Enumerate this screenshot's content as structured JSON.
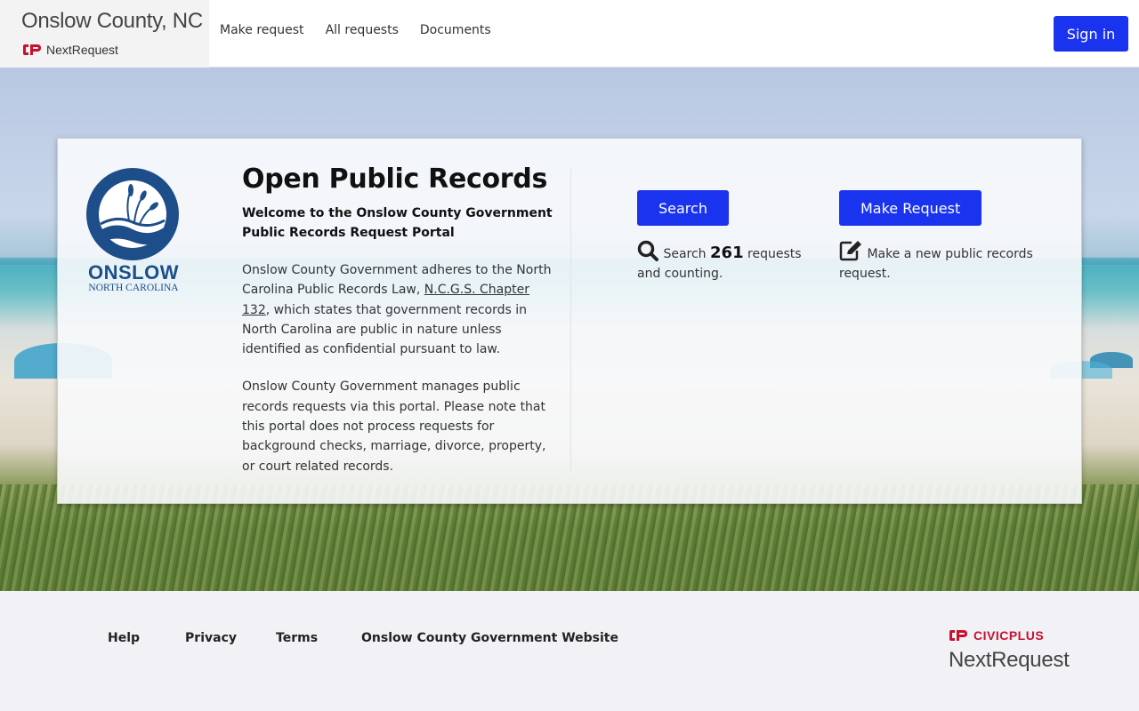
{
  "header": {
    "brand_title": "Onslow County, NC",
    "brand_sub": "NextRequest",
    "nav": [
      "Make request",
      "All requests",
      "Documents"
    ],
    "signin_label": "Sign in"
  },
  "logo": {
    "name": "ONSLOW",
    "state": "NORTH CAROLINA"
  },
  "intro": {
    "title": "Open Public Records",
    "welcome": "Welcome to the Onslow County Government Public Records Request Portal",
    "para1_before": "Onslow County Government adheres to the North Carolina Public Records Law, ",
    "para1_link": "N.C.G.S. Chapter 132",
    "para1_after": ", which states that government records in North Carolina are public in nature unless identified as confidential pursuant to law.",
    "para2": "Onslow County Government manages public records requests via this portal. Please note that this portal does not process requests for background checks, marriage, divorce, property, or court related records."
  },
  "search": {
    "button_label": "Search",
    "desc_before": "Search ",
    "count": "261",
    "desc_after": " requests and counting."
  },
  "make_request": {
    "button_label": "Make Request",
    "desc": "Make a new public records request."
  },
  "footer": {
    "links": [
      "Help",
      "Privacy",
      "Terms",
      "Onslow County Government Website"
    ],
    "civic": "CIVICPLUS",
    "product": "NextRequest"
  },
  "colors": {
    "primary": "#1a33ee",
    "brand_red": "#c8102e",
    "logo_blue": "#1d4e8a"
  }
}
